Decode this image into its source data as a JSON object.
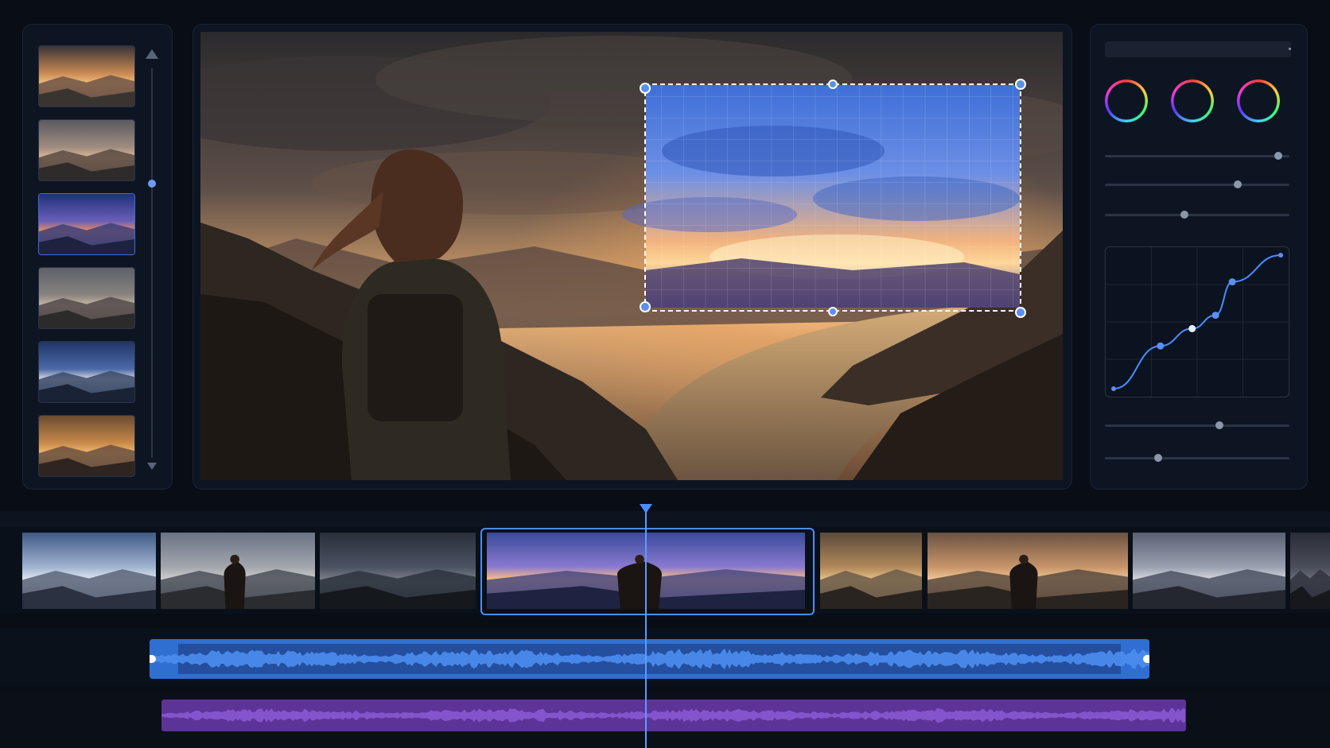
{
  "theme": {
    "background": "#080d16",
    "panel": "#0e1522",
    "accent": "#4a8dff",
    "audio_primary": "#2f6fd1",
    "audio_secondary": "#6a3fb0"
  },
  "thumbnail_strip": {
    "items": [
      {
        "label": "",
        "scene": "sunset-lake"
      },
      {
        "label": "",
        "scene": "mountain-clouds"
      },
      {
        "label": "",
        "scene": "blue-dusk-lake",
        "selected": true
      },
      {
        "label": "",
        "scene": "overcast-valley"
      },
      {
        "label": "",
        "scene": "stormy-blue"
      },
      {
        "label": "",
        "scene": "golden-valley"
      }
    ],
    "scroll_up_icon": "triangle-up-icon",
    "scroll_down_icon": "triangle-down-icon",
    "scroll_position": 0.33
  },
  "viewer": {
    "scene": "hiker-overlooking-river-at-sunset",
    "crop_selection": {
      "grid": "8x8",
      "handles": 6
    }
  },
  "color_panel": {
    "wheels": [
      "shadows-wheel",
      "midtones-wheel",
      "highlights-wheel"
    ],
    "sliders_top": [
      0.94,
      0.72,
      0.43
    ],
    "curve_points": [
      [
        0,
        0
      ],
      [
        0.28,
        0.32
      ],
      [
        0.47,
        0.45
      ],
      [
        0.61,
        0.55
      ],
      [
        0.71,
        0.8
      ],
      [
        1,
        1
      ]
    ],
    "sliders_bottom": [
      0.62,
      0.29
    ]
  },
  "timeline": {
    "playhead_position": 0.49,
    "clips": [
      {
        "scene": "snowy-peaks"
      },
      {
        "scene": "hiker-valley"
      },
      {
        "scene": "dark-ridge"
      },
      {
        "scene": "hiker-sunset-lake",
        "selected": true
      },
      {
        "scene": "golden-cliff"
      },
      {
        "scene": "hiker-golden"
      },
      {
        "scene": "misty-lake"
      },
      {
        "scene": "dark-peak"
      }
    ],
    "audio_tracks": [
      {
        "name": "",
        "color": "#2f6fd1",
        "selected": true
      },
      {
        "name": "",
        "color": "#6a3fb0",
        "selected": false
      }
    ]
  }
}
